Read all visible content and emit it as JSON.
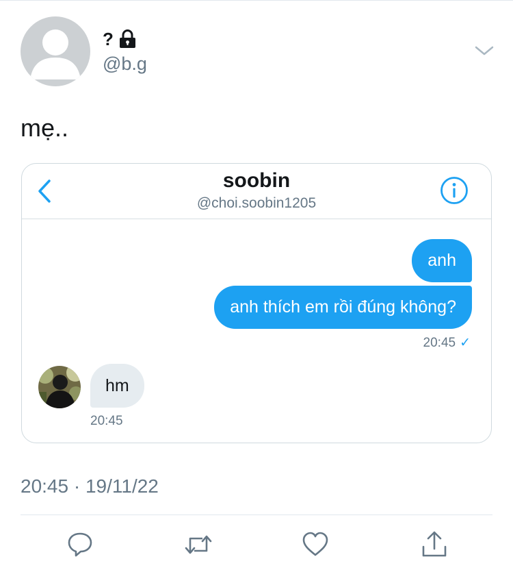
{
  "tweet": {
    "author": {
      "display_name": "?",
      "handle": "@b.g",
      "lock_icon": "lock-icon",
      "avatar": "default-avatar"
    },
    "menu_icon": "chevron-down-icon",
    "text": "mẹ..",
    "meta": "20:45 · 19/11/22"
  },
  "embedded_dm": {
    "header": {
      "name": "soobin",
      "handle": "@choi.soobin1205",
      "back_icon": "chevron-left-icon",
      "info_icon": "info-icon"
    },
    "messages_out": [
      {
        "text": "anh"
      },
      {
        "text": "anh thích em rồi đúng không?"
      }
    ],
    "out_timestamp": "20:45",
    "out_status": "✓",
    "message_in": {
      "text": "hm",
      "timestamp": "20:45"
    }
  },
  "actions": [
    {
      "name": "reply",
      "icon": "reply-icon"
    },
    {
      "name": "retweet",
      "icon": "retweet-icon"
    },
    {
      "name": "like",
      "icon": "heart-icon"
    },
    {
      "name": "share",
      "icon": "share-icon"
    }
  ],
  "colors": {
    "accent": "#1da1f2",
    "secondary_text": "#657786",
    "incoming_bubble": "#e6ecf0",
    "divider": "#e1e8ed"
  }
}
